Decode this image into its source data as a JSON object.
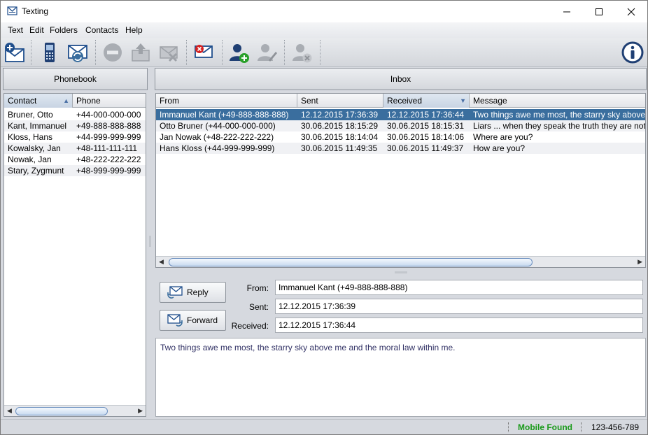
{
  "window": {
    "title": "Texting"
  },
  "menu": [
    "Text",
    "Edit",
    "Folders",
    "Contacts",
    "Help"
  ],
  "phonebook": {
    "header": "Phonebook",
    "columns": [
      "Contact",
      "Phone"
    ],
    "rows": [
      {
        "contact": "Bruner, Otto",
        "phone": "+44-000-000-000"
      },
      {
        "contact": "Kant, Immanuel",
        "phone": "+49-888-888-888"
      },
      {
        "contact": "Kloss, Hans",
        "phone": "+44-999-999-999"
      },
      {
        "contact": "Kowalsky, Jan",
        "phone": "+48-111-111-111"
      },
      {
        "contact": "Nowak, Jan",
        "phone": "+48-222-222-222"
      },
      {
        "contact": "Stary, Zygmunt",
        "phone": "+48-999-999-999"
      }
    ]
  },
  "inbox": {
    "header": "Inbox",
    "columns": [
      "From",
      "Sent",
      "Received",
      "Message"
    ],
    "rows": [
      {
        "from": "Immanuel Kant (+49-888-888-888)",
        "sent": "12.12.2015 17:36:39",
        "received": "12.12.2015 17:36:44",
        "message": "Two things awe me most, the starry sky above"
      },
      {
        "from": "Otto Bruner (+44-000-000-000)",
        "sent": "30.06.2015 18:15:29",
        "received": "30.06.2015 18:15:31",
        "message": "Liars ... when they speak the truth they are not"
      },
      {
        "from": "Jan Nowak (+48-222-222-222)",
        "sent": "30.06.2015 18:14:04",
        "received": "30.06.2015 18:14:06",
        "message": "Where are you?"
      },
      {
        "from": "Hans Kloss (+44-999-999-999)",
        "sent": "30.06.2015 11:49:35",
        "received": "30.06.2015 11:49:37",
        "message": "How are you?"
      }
    ]
  },
  "detail": {
    "reply_label": "Reply",
    "forward_label": "Forward",
    "from_label": "From:",
    "sent_label": "Sent:",
    "received_label": "Received:",
    "from_value": "Immanuel Kant (+49-888-888-888)",
    "sent_value": "12.12.2015 17:36:39",
    "received_value": "12.12.2015 17:36:44",
    "body": "Two things awe me most, the starry sky above me and the moral law within me."
  },
  "status": {
    "mobile": "Mobile Found",
    "number": "123-456-789",
    "mobile_color": "#1a9a1a"
  },
  "colors": {
    "selection": "#3a6e9e",
    "accent": "#1f4e8c"
  }
}
